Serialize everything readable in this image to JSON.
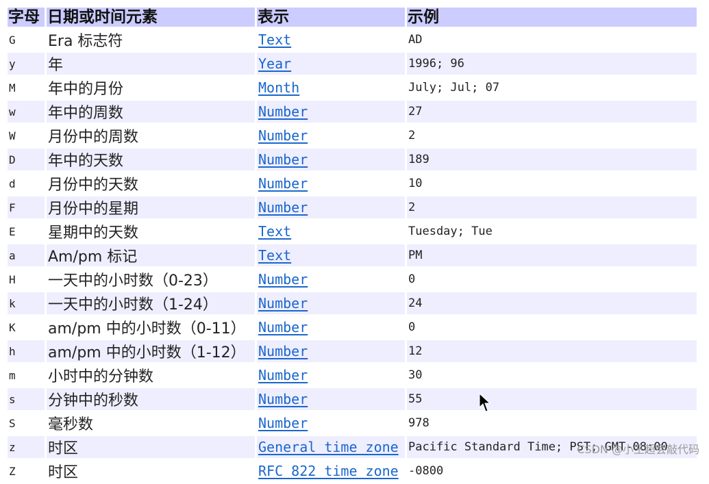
{
  "table": {
    "headers": [
      "字母",
      "日期或时间元素",
      "表示",
      "示例"
    ],
    "rows": [
      {
        "letter": "G",
        "element": "Era 标志符",
        "presentation": "Text",
        "example": "AD"
      },
      {
        "letter": "y",
        "element": "年",
        "presentation": "Year",
        "example": "1996; 96"
      },
      {
        "letter": "M",
        "element": "年中的月份",
        "presentation": "Month",
        "example": "July; Jul; 07"
      },
      {
        "letter": "w",
        "element": "年中的周数",
        "presentation": "Number",
        "example": "27"
      },
      {
        "letter": "W",
        "element": "月份中的周数",
        "presentation": "Number",
        "example": "2"
      },
      {
        "letter": "D",
        "element": "年中的天数",
        "presentation": "Number",
        "example": "189"
      },
      {
        "letter": "d",
        "element": "月份中的天数",
        "presentation": "Number",
        "example": "10"
      },
      {
        "letter": "F",
        "element": "月份中的星期",
        "presentation": "Number",
        "example": "2"
      },
      {
        "letter": "E",
        "element": "星期中的天数",
        "presentation": "Text",
        "example": "Tuesday; Tue"
      },
      {
        "letter": "a",
        "element": "Am/pm 标记",
        "presentation": "Text",
        "example": "PM"
      },
      {
        "letter": "H",
        "element": "一天中的小时数（0-23）",
        "presentation": "Number",
        "example": "0"
      },
      {
        "letter": "k",
        "element": "一天中的小时数（1-24）",
        "presentation": "Number",
        "example": "24"
      },
      {
        "letter": "K",
        "element": "am/pm 中的小时数（0-11）",
        "presentation": "Number",
        "example": "0"
      },
      {
        "letter": "h",
        "element": "am/pm 中的小时数（1-12）",
        "presentation": "Number",
        "example": "12"
      },
      {
        "letter": "m",
        "element": "小时中的分钟数",
        "presentation": "Number",
        "example": "30"
      },
      {
        "letter": "s",
        "element": "分钟中的秒数",
        "presentation": "Number",
        "example": "55"
      },
      {
        "letter": "S",
        "element": "毫秒数",
        "presentation": "Number",
        "example": "978"
      },
      {
        "letter": "z",
        "element": "时区",
        "presentation": "General time zone",
        "example": "Pacific Standard Time; PST; GMT-08:00"
      },
      {
        "letter": "Z",
        "element": "时区",
        "presentation": "RFC 822 time zone",
        "example": "-0800"
      }
    ]
  },
  "watermark": "CSDN @小王超会敲代码",
  "colors": {
    "header_bg": "#ccccff",
    "alt_row_bg": "#eeeeff",
    "link": "#1a66cc"
  }
}
